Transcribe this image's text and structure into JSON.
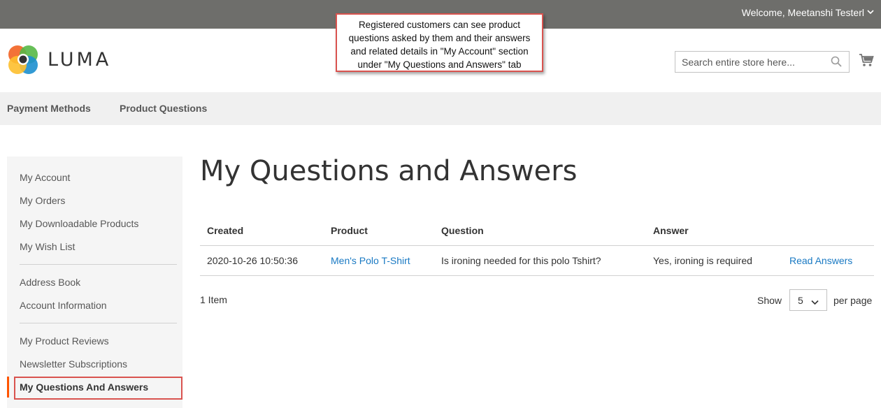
{
  "header": {
    "welcome": "Welcome, Meetanshi Testerl",
    "logo_text": "LUMA",
    "search_placeholder": "Search entire store here..."
  },
  "callout": {
    "lines": [
      "Registered customers can see product",
      "questions asked by them and their answers",
      "and related details in \"My Account\" section",
      "under \"My Questions and Answers\" tab"
    ]
  },
  "nav": {
    "items": [
      "Payment Methods",
      "Product Questions"
    ]
  },
  "sidebar": {
    "group1": [
      "My Account",
      "My Orders",
      "My Downloadable Products",
      "My Wish List"
    ],
    "group2": [
      "Address Book",
      "Account Information"
    ],
    "group3": [
      "My Product Reviews",
      "Newsletter Subscriptions"
    ],
    "active": "My Questions And Answers"
  },
  "main": {
    "title": "My Questions and Answers",
    "table": {
      "headers": [
        "Created",
        "Product",
        "Question",
        "Answer"
      ],
      "rows": [
        {
          "created": "2020-10-26 10:50:36",
          "product": "Men's Polo T-Shirt",
          "question": "Is ironing needed for this polo Tshirt?",
          "answer": "Yes, ironing is required",
          "action": "Read Answers"
        }
      ]
    },
    "pager": {
      "items": "1 Item",
      "show_label": "Show",
      "per_page_value": "5",
      "per_page_label": "per page"
    }
  },
  "colors": {
    "topbar": "#6e6e6b",
    "link": "#1979c3",
    "active_accent": "#ff5501",
    "highlight_border": "#d9534f"
  }
}
